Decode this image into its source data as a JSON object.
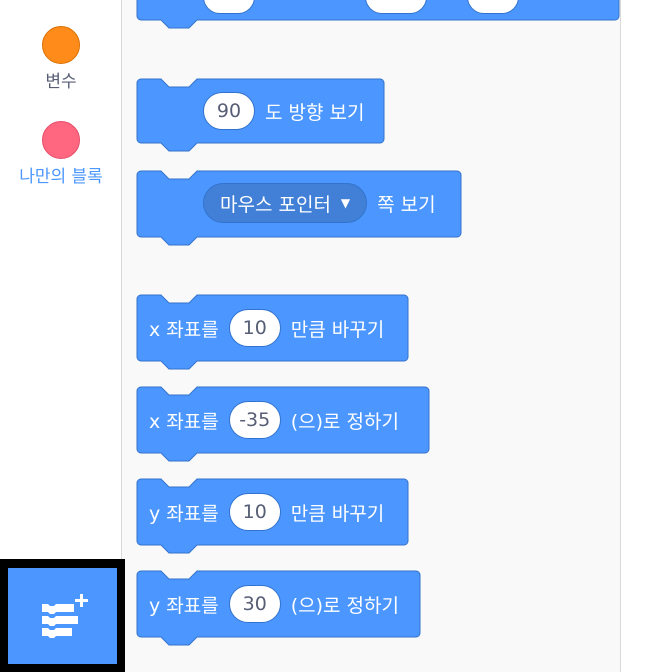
{
  "colors": {
    "motion_block": "#4c97ff",
    "motion_block_border": "#3373cc",
    "dropdown_fill": "#4280d7",
    "input_text": "#575e75",
    "variables_category": "#ff8c1a",
    "my_blocks_category": "#ff6680",
    "my_blocks_label": "#4c97ff",
    "extension_frame": "#000000"
  },
  "sidebar": {
    "categories": [
      {
        "label": "변수",
        "color": "#ff8c1a",
        "label_color": "#575e75"
      },
      {
        "label": "나만의 블록",
        "color": "#ff6680",
        "label_color": "#4c97ff"
      }
    ],
    "extension_button": {
      "icon": "add-extension-icon"
    }
  },
  "blocks": {
    "point_in_direction": {
      "value": "90",
      "text": "도 방향 보기"
    },
    "point_towards": {
      "menu_value": "마우스 포인터",
      "text": "쪽 보기"
    },
    "change_x": {
      "prefix": "x 좌표를",
      "value": "10",
      "suffix": "만큼 바꾸기"
    },
    "set_x": {
      "prefix": "x 좌표를",
      "value": "-35",
      "suffix": "(으)로 정하기"
    },
    "change_y": {
      "prefix": "y 좌표를",
      "value": "10",
      "suffix": "만큼 바꾸기"
    },
    "set_y": {
      "prefix": "y 좌표를",
      "value": "30",
      "suffix": "(으)로 정하기"
    }
  }
}
